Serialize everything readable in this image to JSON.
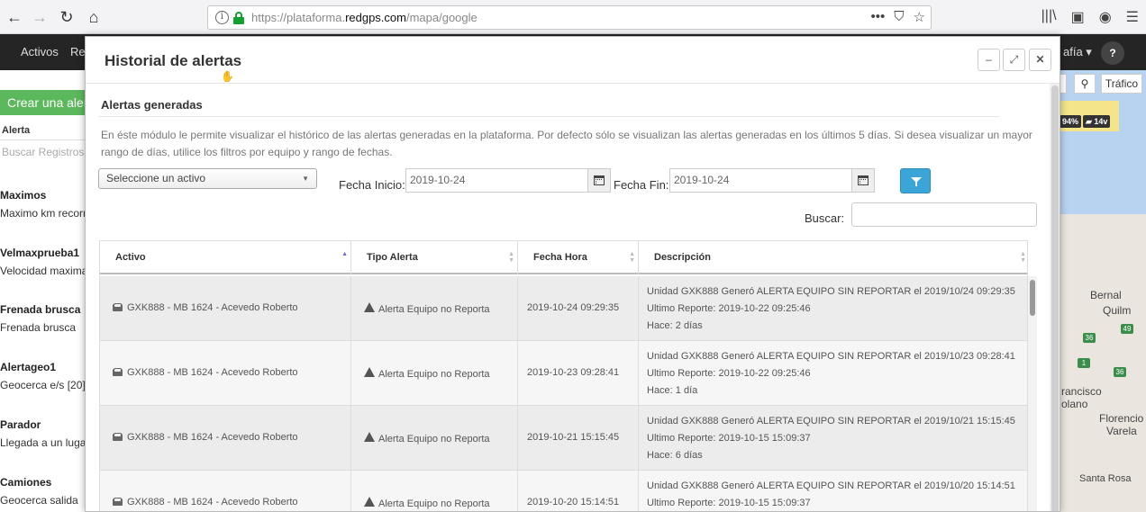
{
  "browser": {
    "url_prefix": "https://plataforma.",
    "url_host": "redgps.com",
    "url_path": "/mapa/google",
    "back": "←",
    "forward": "→",
    "reload": "↻",
    "home": "⌂",
    "more": "•••",
    "lib": "|||\\",
    "menu": "☰"
  },
  "app_nav": {
    "items": [
      "Activos",
      "Re"
    ],
    "right_item": "afía ▾",
    "help": "?"
  },
  "sidebar": {
    "create_label": "Crear una alerta",
    "header": "Alerta",
    "search_placeholder": "Buscar Registros",
    "items": [
      {
        "title": "Maximos",
        "subtitle": "Maximo km recorrido"
      },
      {
        "title": "Velmaxprueba1",
        "subtitle": "Velocidad maxima"
      },
      {
        "title": "Frenada brusca",
        "subtitle": "Frenada brusca"
      },
      {
        "title": "Alertageo1",
        "subtitle": "Geocerca e/s [20]"
      },
      {
        "title": "Parador",
        "subtitle": "Llegada a un lugar"
      },
      {
        "title": "Camiones",
        "subtitle": "Geocerca salida"
      }
    ]
  },
  "map": {
    "traffic_label": "Tráfico",
    "battery": "94%",
    "voltage": "14v",
    "labels": [
      "Bernal",
      "Quilm",
      "rancisco",
      "olano",
      "Florencio",
      "Varela",
      "Santa Rosa"
    ],
    "routes": [
      "36",
      "49",
      "1",
      "36"
    ]
  },
  "modal": {
    "title": "Historial de alertas",
    "section_title": "Alertas generadas",
    "description": "En éste módulo le permite visualizar el histórico de las alertas generadas en la plataforma. Por defecto sólo se visualizan las alertas generadas en los últimos 5 días. Si desea visualizar un mayor rango de días, utilice los filtros por equipo y rango de fechas.",
    "asset_select": "Seleccione un activo",
    "fecha_inicio_label": "Fecha Inicio:",
    "fecha_inicio_value": "2019-10-24",
    "fecha_fin_label": "Fecha Fin:",
    "fecha_fin_value": "2019-10-24",
    "search_label": "Buscar:",
    "search_value": "",
    "columns": [
      "Activo",
      "Tipo Alerta",
      "Fecha Hora",
      "Descripción"
    ],
    "rows": [
      {
        "activo": "GXK888 - MB 1624 - Acevedo Roberto",
        "tipo": "Alerta Equipo no Reporta",
        "fecha": "2019-10-24 09:29:35",
        "desc1": "Unidad GXK888 Generó ALERTA EQUIPO SIN REPORTAR el 2019/10/24 09:29:35",
        "desc2": "Ultimo Reporte: 2019-10-22 09:25:46",
        "desc3": "Hace: 2 días"
      },
      {
        "activo": "GXK888 - MB 1624 - Acevedo Roberto",
        "tipo": "Alerta Equipo no Reporta",
        "fecha": "2019-10-23 09:28:41",
        "desc1": "Unidad GXK888 Generó ALERTA EQUIPO SIN REPORTAR el 2019/10/23 09:28:41",
        "desc2": "Ultimo Reporte: 2019-10-22 09:25:46",
        "desc3": "Hace: 1 día"
      },
      {
        "activo": "GXK888 - MB 1624 - Acevedo Roberto",
        "tipo": "Alerta Equipo no Reporta",
        "fecha": "2019-10-21 15:15:45",
        "desc1": "Unidad GXK888 Generó ALERTA EQUIPO SIN REPORTAR el 2019/10/21 15:15:45",
        "desc2": "Ultimo Reporte: 2019-10-15 15:09:37",
        "desc3": "Hace: 6 días"
      },
      {
        "activo": "GXK888 - MB 1624 - Acevedo Roberto",
        "tipo": "Alerta Equipo no Reporta",
        "fecha": "2019-10-20 15:14:51",
        "desc1": "Unidad GXK888 Generó ALERTA EQUIPO SIN REPORTAR el 2019/10/20 15:14:51",
        "desc2": "Ultimo Reporte: 2019-10-15 15:09:37",
        "desc3": ""
      }
    ]
  }
}
